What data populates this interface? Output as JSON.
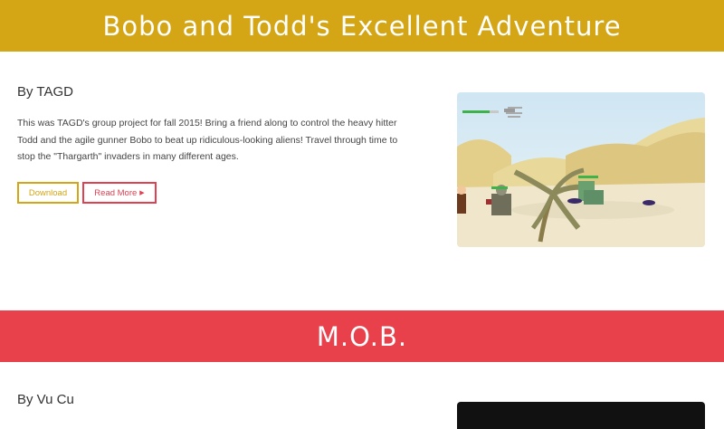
{
  "projects": [
    {
      "title": "Bobo and Todd's Excellent Adventure",
      "author": "By TAGD",
      "description": "This was TAGD's group project for fall 2015! Bring a friend along to control the heavy hitter Todd and the agile gunner Bobo to beat up ridiculous-looking aliens! Travel through time to stop the \"Thargarth\" invaders in many different ages.",
      "download_label": "Download",
      "read_more_label": "Read More",
      "read_more_icon": "caret-right-icon",
      "band_color": "#d4a514"
    },
    {
      "title": "M.O.B.",
      "author": "By Vu Cu",
      "band_color": "#e8414c"
    }
  ]
}
